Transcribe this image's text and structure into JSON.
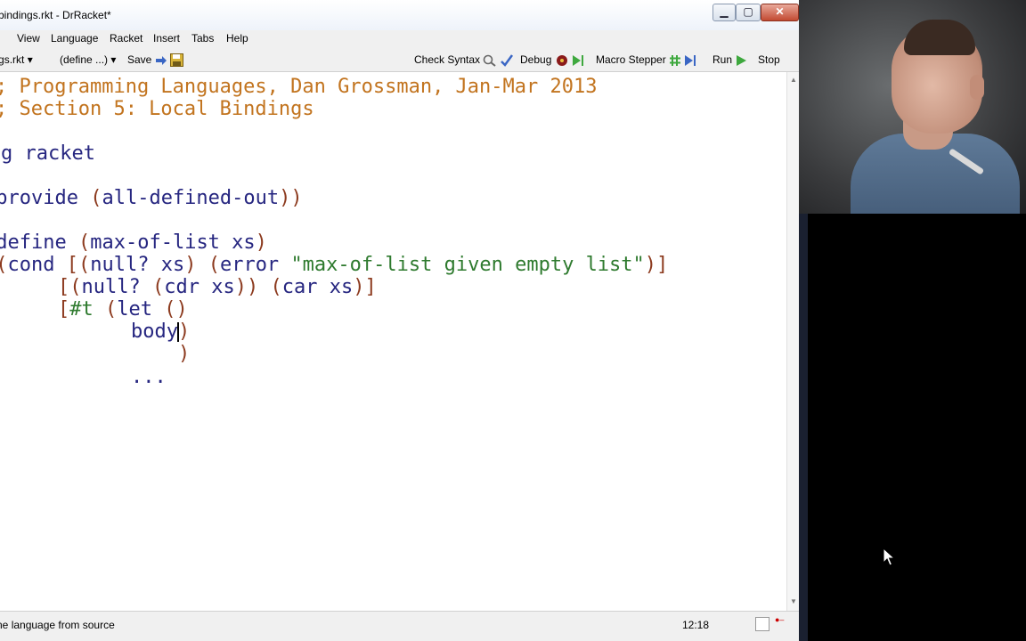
{
  "window": {
    "title": "bindings.rkt - DrRacket*",
    "minimize_glyph": "▁",
    "maximize_glyph": "▢",
    "close_glyph": "✕"
  },
  "menu": [
    "View",
    "Language",
    "Racket",
    "Insert",
    "Tabs",
    "Help"
  ],
  "toolbar": {
    "file_selector": "bindings.rkt",
    "define_selector": "(define ...)",
    "save": "Save",
    "check_syntax": "Check Syntax",
    "debug": "Debug",
    "macro_stepper": "Macro Stepper",
    "run": "Run",
    "stop": "Stop"
  },
  "code": {
    "line1": "; Programming Languages, Dan Grossman, Jan-Mar 2013",
    "line2": "; Section 5: Local Bindings",
    "line4_kw": "#lang racket",
    "line6_a": "provide",
    "line6_b": "all-defined-out",
    "line8_kw": "define",
    "line8_fn": "max-of-list xs",
    "line9_kw": "cond",
    "line9_a": "null? xs",
    "line9_b": "error",
    "line9_str": "\"max-of-list given empty list\"",
    "line10_a": "null?",
    "line10_b": "cdr xs",
    "line10_c": "car xs",
    "line11_hash": "#t",
    "line11_kw": "let",
    "line12_body": "body",
    "line14_dots": "..."
  },
  "status": {
    "left": "Determine language from source",
    "position": "12:18"
  },
  "colors": {
    "comment": "#c2741f",
    "paren": "#8c3a1e",
    "symbol": "#262680",
    "string": "#2e7a2e"
  }
}
